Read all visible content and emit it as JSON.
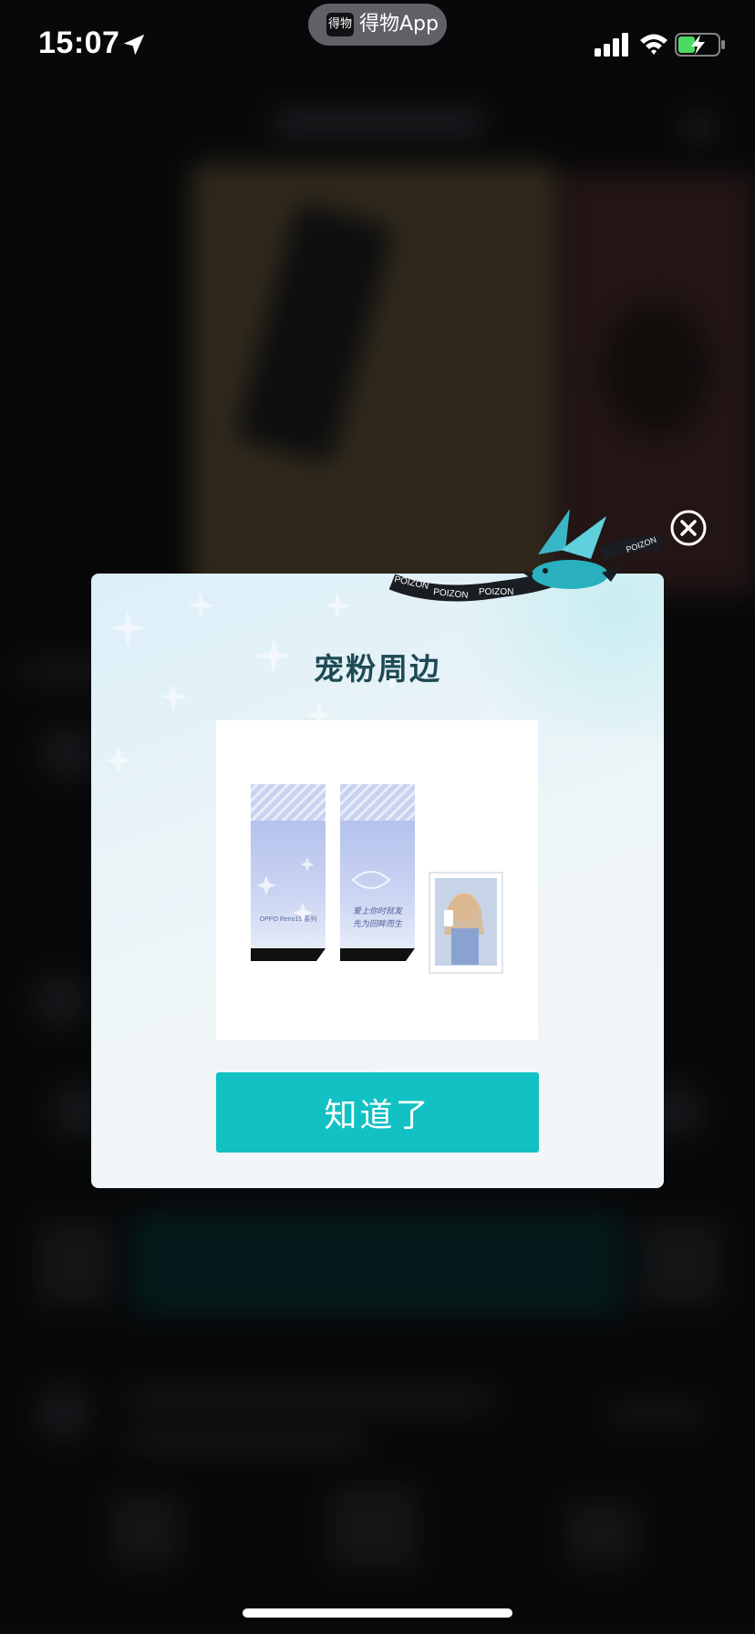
{
  "status_bar": {
    "time": "15:07",
    "app_pill_logo": "得物",
    "app_pill_label": "得物App"
  },
  "modal": {
    "title": "宠粉周边",
    "confirm_label": "知道了",
    "product_image_text": {
      "box_caption": "OPPO Reno15 系列",
      "box_handwriting": "爱上你时就发\n先为回眸而生"
    },
    "ribbon_text": [
      "POIZON",
      "POIZON",
      "POIZON",
      "POIZON"
    ]
  },
  "colors": {
    "accent": "#12c1c3",
    "title": "#1e4a55",
    "box_blue": "#aebcea"
  },
  "icons": [
    "location-arrow-icon",
    "signal-icon",
    "wifi-icon",
    "battery-charging-icon",
    "close-icon",
    "bird-mascot-icon"
  ]
}
